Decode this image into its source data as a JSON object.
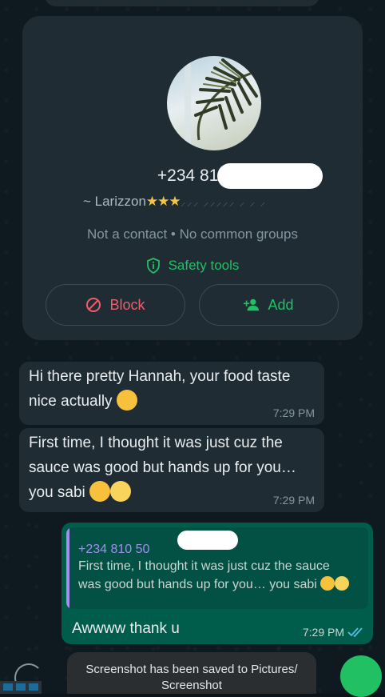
{
  "profile": {
    "phone": "+234 810",
    "push_name_prefix": "~ Larizzon",
    "push_name_stars": "★★★",
    "push_name_faded": "⸝⸝⸝ ⸝⸝⸝⸝⸝ ⸝ ⸝ ⸝",
    "meta": "Not a contact • No common groups",
    "safety_label": "Safety tools",
    "block_label": "Block",
    "add_label": "Add"
  },
  "messages": [
    {
      "text": "Hi there pretty Hannah, your food taste nice actually",
      "time": "7:29 PM"
    },
    {
      "text": "First time, I thought it was just cuz the sauce was good but hands up for you… you sabi",
      "time": "7:29 PM"
    }
  ],
  "reply": {
    "quoted_name": "+234 810 50",
    "quoted_text": "First time, I thought it was just cuz the sauce was good but hands up for you… you sabi",
    "text": "Awwww thank u",
    "time": "7:29 PM",
    "status": "read"
  },
  "toast": {
    "line1": "Screenshot has been saved to  Pictures/",
    "line2": "Screenshot"
  },
  "colors": {
    "accent": "#21c063",
    "danger": "#f15c6d",
    "outgoing_bubble": "#005c4b",
    "incoming_bubble": "#1f2c34",
    "quote_name": "#a58cf0"
  }
}
